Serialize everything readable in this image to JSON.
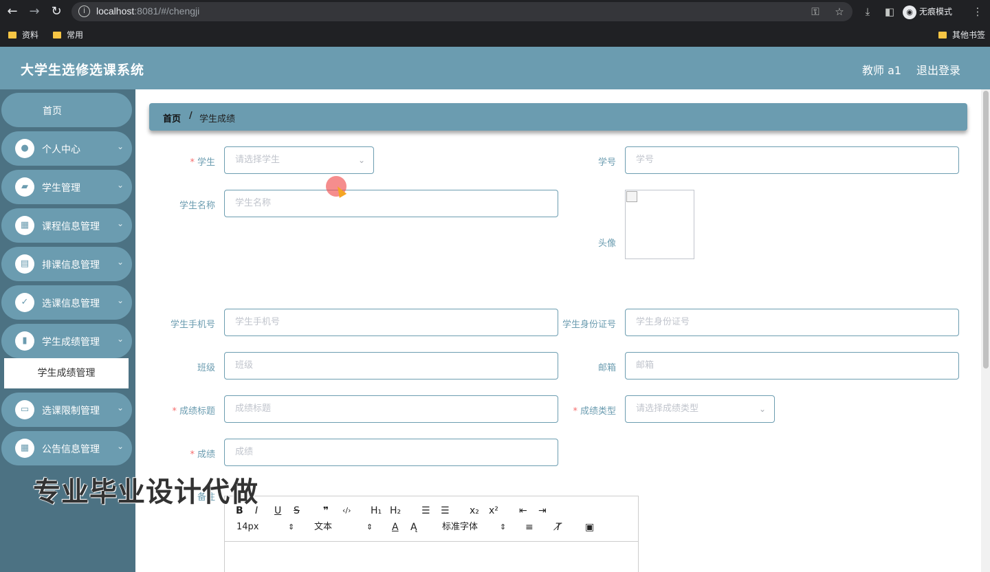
{
  "browser": {
    "url_host": "localhost",
    "url_rest": ":8081/#/chengji",
    "incognito_label": "无痕模式",
    "bookmarks": [
      "资料",
      "常用"
    ],
    "other_bookmarks": "其他书签"
  },
  "header": {
    "title": "大学生选修选课系统",
    "teacher": "教师 a1",
    "logout": "退出登录"
  },
  "sidebar": {
    "home": "首页",
    "items": [
      {
        "label": "个人中心",
        "icon": "user-icon"
      },
      {
        "label": "学生管理",
        "icon": "briefcase-icon"
      },
      {
        "label": "课程信息管理",
        "icon": "grid-icon"
      },
      {
        "label": "排课信息管理",
        "icon": "clipboard-icon"
      },
      {
        "label": "选课信息管理",
        "icon": "clipboard-check-icon"
      },
      {
        "label": "学生成绩管理",
        "icon": "bar-chart-icon"
      },
      {
        "label": "选课限制管理",
        "icon": "monitor-icon"
      },
      {
        "label": "公告信息管理",
        "icon": "grid-icon"
      }
    ],
    "active_sub": "学生成绩管理"
  },
  "breadcrumb": {
    "home": "首页",
    "sep": "/",
    "current": "学生成绩"
  },
  "form": {
    "student_label": "学生",
    "student_placeholder": "请选择学生",
    "xuehao_label": "学号",
    "xuehao_placeholder": "学号",
    "name_label": "学生名称",
    "name_placeholder": "学生名称",
    "avatar_label": "头像",
    "phone_label": "学生手机号",
    "phone_placeholder": "学生手机号",
    "idcard_label": "学生身份证号",
    "idcard_placeholder": "学生身份证号",
    "class_label": "班级",
    "class_placeholder": "班级",
    "email_label": "邮箱",
    "email_placeholder": "邮箱",
    "title_label": "成绩标题",
    "title_placeholder": "成绩标题",
    "type_label": "成绩类型",
    "type_placeholder": "请选择成绩类型",
    "score_label": "成绩",
    "score_placeholder": "成绩",
    "note_label": "备注",
    "required_mark": "*"
  },
  "editor": {
    "font_size": "14px",
    "block": "文本",
    "font_family": "标准字体"
  },
  "watermark": "专业毕业设计代做",
  "colors": {
    "accent": "#6b9cb0",
    "sidebar": "#4c7283",
    "required": "#f56c6c"
  }
}
